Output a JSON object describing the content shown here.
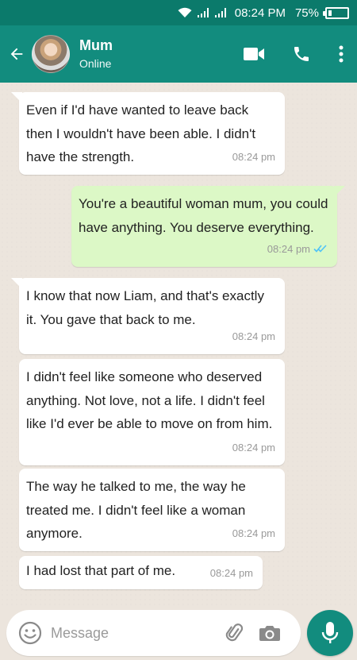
{
  "status_bar": {
    "time": "08:24 PM",
    "battery": "75%",
    "battery_level": 0.75,
    "icons": [
      "wifi-icon",
      "signal-icon",
      "signal-icon",
      "battery-icon"
    ]
  },
  "header": {
    "contact_name": "Mum",
    "contact_status": "Online",
    "icons": [
      "back-arrow-icon",
      "avatar",
      "video-call-icon",
      "phone-icon",
      "more-vert-icon"
    ]
  },
  "messages": [
    {
      "direction": "in",
      "text": "Even if I'd have wanted to leave back then I wouldn't have been able. I didn't have the strength.",
      "time": "08:24 pm",
      "tail": true
    },
    {
      "direction": "out",
      "text": "You're a beautiful woman mum, you could have anything. You deserve everything.",
      "time": "08:24 pm",
      "tail": true,
      "read": true
    },
    {
      "direction": "in",
      "text": "I know that now Liam, and that's exactly it. You gave that back to me.",
      "time": "08:24 pm",
      "tail": true
    },
    {
      "direction": "in",
      "text": "I didn't feel like someone who deserved anything. Not love, not a life. I didn't feel like I'd ever be able to move on from him.",
      "time": "08:24 pm",
      "tail": false
    },
    {
      "direction": "in",
      "text": "The way he talked to me, the way he treated me. I didn't feel like a woman anymore.",
      "time": "08:24 pm",
      "tail": false
    },
    {
      "direction": "in",
      "text": "I had lost that part of me.",
      "time": "08:24 pm",
      "tail": false
    }
  ],
  "composer": {
    "placeholder": "Message",
    "icons": [
      "emoji-icon",
      "paperclip-icon",
      "camera-icon",
      "mic-icon"
    ]
  },
  "colors": {
    "header": "#128c7e",
    "status_bar": "#0b7a6b",
    "incoming_bubble": "#ffffff",
    "outgoing_bubble": "#dcf8c6",
    "read_ticks": "#4fc3f7",
    "background": "#ece5dd"
  }
}
